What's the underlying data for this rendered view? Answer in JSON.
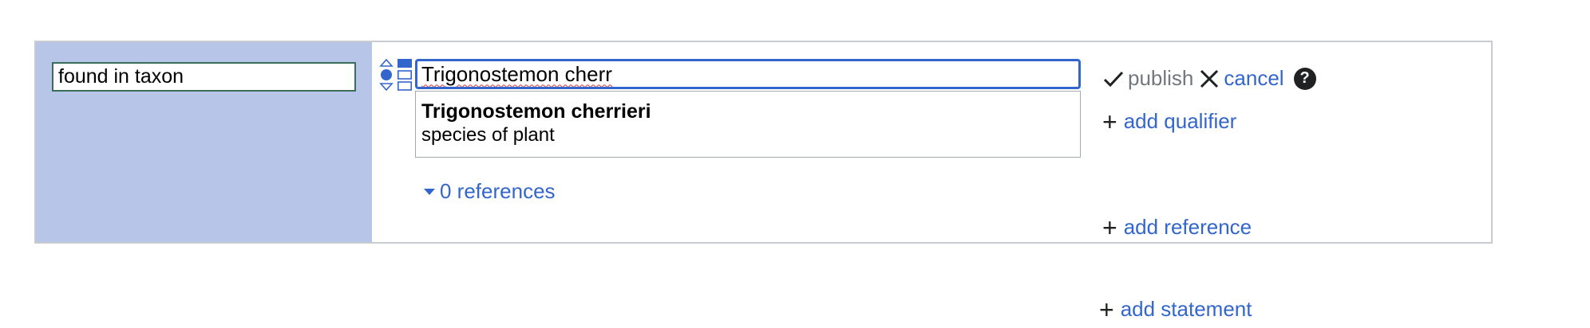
{
  "property": {
    "value": "found in taxon"
  },
  "value_input": {
    "value": "Trigonostemon cherr"
  },
  "suggestion": {
    "label": "Trigonostemon cherrieri",
    "description": "species of plant"
  },
  "references": {
    "label": "0 references"
  },
  "toolbar": {
    "publish_label": "publish",
    "cancel_label": "cancel",
    "help_label": "?"
  },
  "actions": {
    "add_qualifier": "add qualifier",
    "add_reference": "add reference",
    "add_statement": "add statement"
  },
  "colors": {
    "property_bg": "#b7c6e8",
    "link": "#3366cc",
    "focus_border": "#3366cc",
    "publish_disabled": "#72777d"
  },
  "icons": {
    "rank": "rank-selector-icon",
    "snak": "snak-type-selector-icon",
    "publish": "checkmark-icon",
    "cancel": "close-icon",
    "help": "help-icon",
    "add": "plus-icon",
    "expand": "triangle-down-icon"
  }
}
